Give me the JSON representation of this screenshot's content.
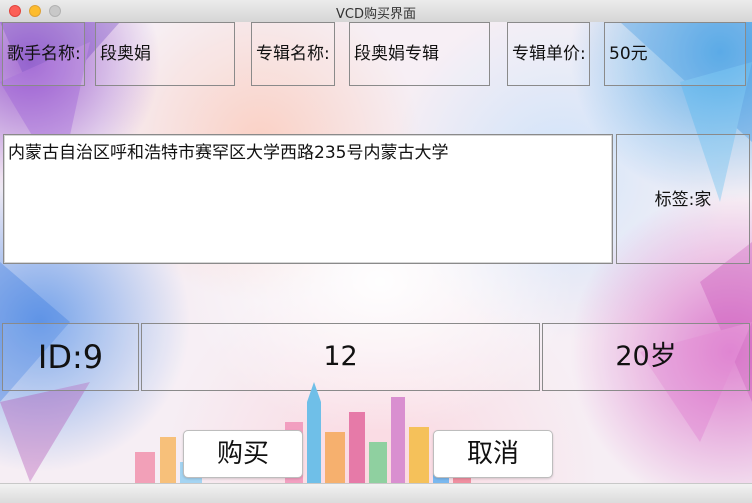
{
  "window": {
    "title": "VCD购买界面"
  },
  "header_row": {
    "singer_label": "歌手名称:",
    "singer_value": "段奥娟",
    "album_label": "专辑名称:",
    "album_value": "段奥娟专辑",
    "price_label": "专辑单价:",
    "price_value": "50元"
  },
  "address": "内蒙古自治区呼和浩特市赛罕区大学西路235号内蒙古大学",
  "tag_label": "标签:家",
  "info_row": {
    "id": "ID:9",
    "number": "12",
    "age": "20岁"
  },
  "buttons": {
    "buy": "购买",
    "cancel": "取消"
  },
  "colors": {
    "accent_purple": "#8c46c8",
    "accent_blue": "#3ca0e6",
    "accent_pink": "#d250be"
  }
}
